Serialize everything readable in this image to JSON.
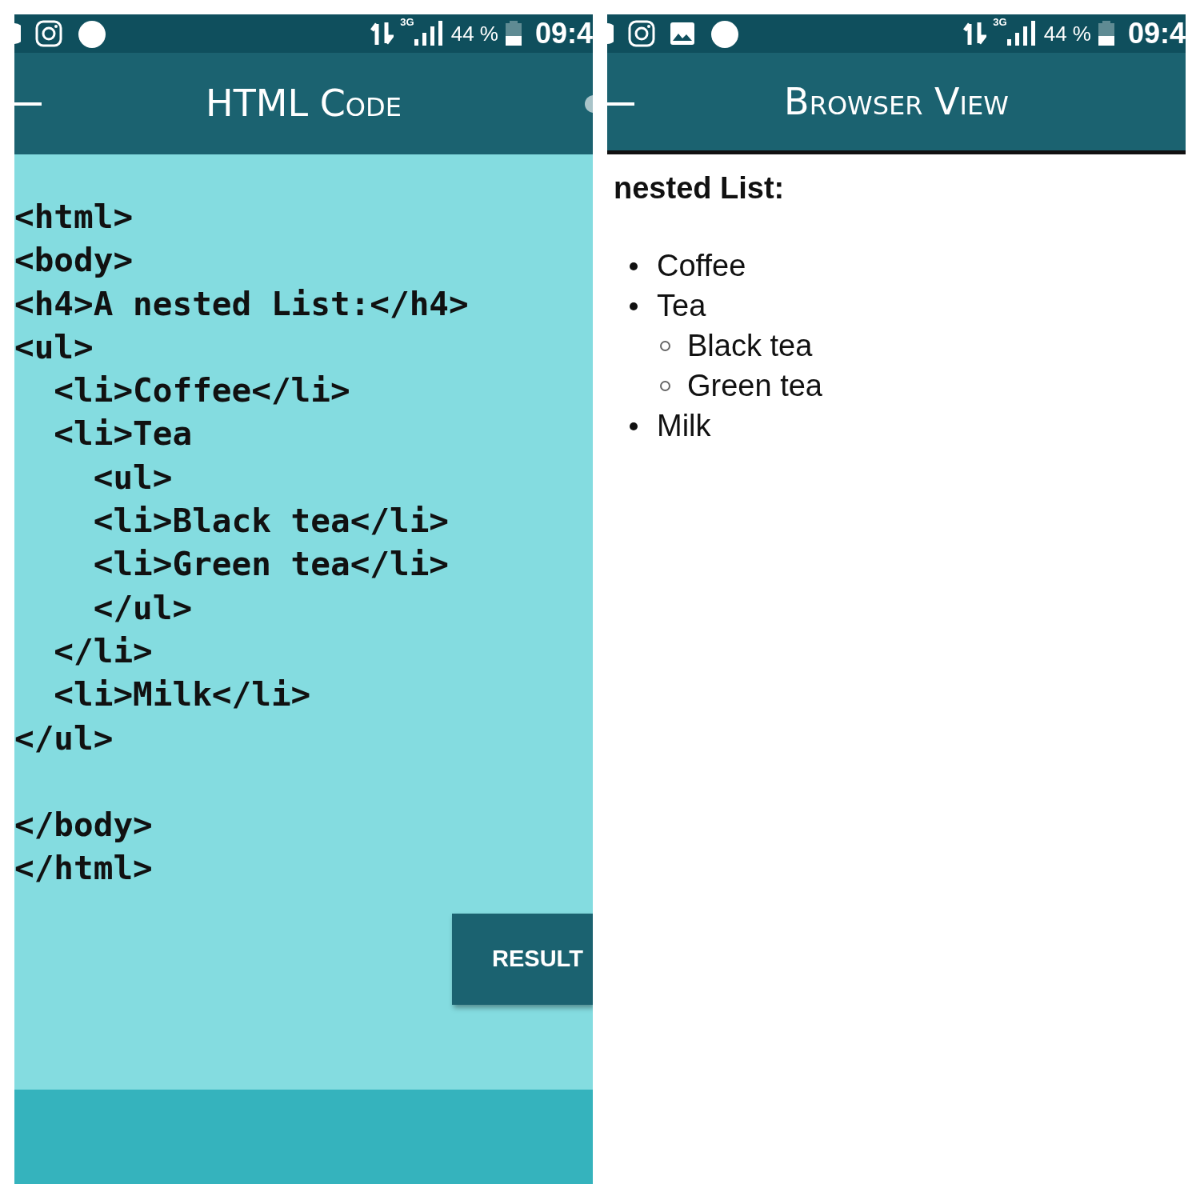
{
  "panels": [
    {
      "kind": "code",
      "status_bar": {
        "notifications": [
          {
            "kind": "cut-dot"
          },
          {
            "kind": "instagram"
          },
          {
            "kind": "dot"
          }
        ],
        "network_type": "3G",
        "battery_text": "44 %",
        "time": "09:4"
      },
      "header": {
        "title": "HTML Code",
        "overflow": true
      },
      "code_lines": [
        {
          "text": "<html>"
        },
        {
          "text": "<body>"
        },
        {
          "text": "<h4>A nested List:</h4>"
        },
        {
          "text": "<ul>"
        },
        {
          "text": "  <li>Coffee</li>"
        },
        {
          "text": "  <li>Tea"
        },
        {
          "text": "    <ul>"
        },
        {
          "text": "    <li>Black tea</li>"
        },
        {
          "text": "    <li>Green tea</li>"
        },
        {
          "text": "    </ul>"
        },
        {
          "text": "  </li>"
        },
        {
          "text": "  <li>Milk</li>"
        },
        {
          "text": "</ul>"
        },
        {
          "text": "</body>",
          "blank_line_before": true
        },
        {
          "text": "</html>"
        }
      ],
      "button": "RESULT"
    },
    {
      "kind": "browser",
      "status_bar": {
        "notifications": [
          {
            "kind": "cut-dot"
          },
          {
            "kind": "instagram"
          },
          {
            "kind": "gallery"
          },
          {
            "kind": "dot"
          }
        ],
        "network_type": "3G",
        "battery_text": "44 %",
        "time": "09:4"
      },
      "header": {
        "title": "Browser View",
        "overflow": false
      },
      "heading": "nested List:",
      "list": [
        {
          "text": "Coffee"
        },
        {
          "text": "Tea",
          "children": [
            {
              "text": "Black tea"
            },
            {
              "text": "Green tea"
            }
          ]
        },
        {
          "text": "Milk"
        }
      ]
    }
  ]
}
